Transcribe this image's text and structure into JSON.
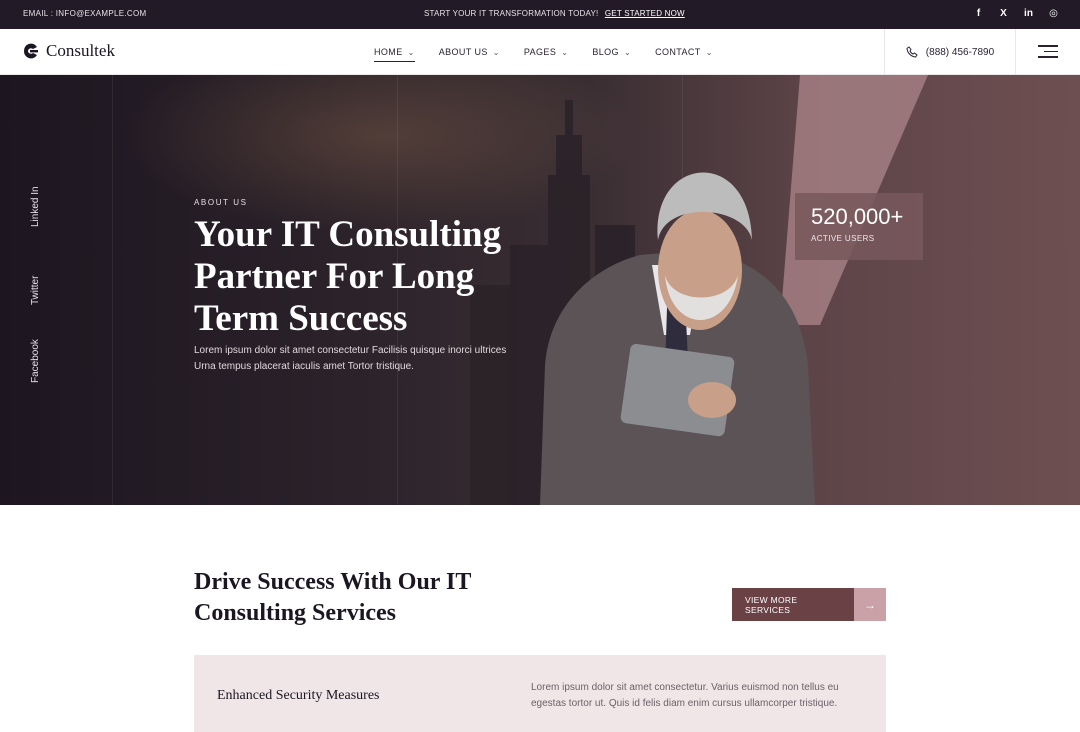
{
  "topbar": {
    "email": "EMAIL : INFO@EXAMPLE.COM",
    "promo_text": "START YOUR IT TRANSFORMATION TODAY!",
    "promo_link": "GET STARTED NOW",
    "socials": [
      "f",
      "X",
      "in",
      "◎"
    ]
  },
  "header": {
    "logo_text": "Consultek",
    "nav": [
      {
        "label": "HOME",
        "chevron": "⌄"
      },
      {
        "label": "ABOUT US",
        "chevron": "⌄"
      },
      {
        "label": "PAGES",
        "chevron": "⌄"
      },
      {
        "label": "BLOG",
        "chevron": "⌄"
      },
      {
        "label": "CONTACT",
        "chevron": "⌄"
      }
    ],
    "phone": "(888) 456-7890"
  },
  "hero": {
    "vertical_socials": [
      "Linked In",
      "Twitter",
      "Facebook"
    ],
    "eyebrow": "ABOUT US",
    "title": "Your IT Consulting Partner For Long Term Success",
    "description": "Lorem ipsum dolor sit amet consectetur Facilisis quisque inorci ultrices Urna tempus placerat iaculis amet Tortor tristique.",
    "stat_number": "520,000+",
    "stat_label": "ACTIVE USERS"
  },
  "services": {
    "title": "Drive Success With Our IT Consulting Services",
    "button_label": "VIEW MORE SERVICES",
    "button_arrow": "→",
    "card_title": "Enhanced Security Measures",
    "card_desc": "Lorem ipsum dolor sit amet consectetur. Varius euismod non tellus eu egestas tortor ut. Quis id felis diam enim cursus ullamcorper tristique."
  },
  "colors": {
    "dark": "#221a27",
    "accent": "#6a4246",
    "accent_light": "#c9a1a6",
    "card_bg": "#f0e6e7"
  }
}
